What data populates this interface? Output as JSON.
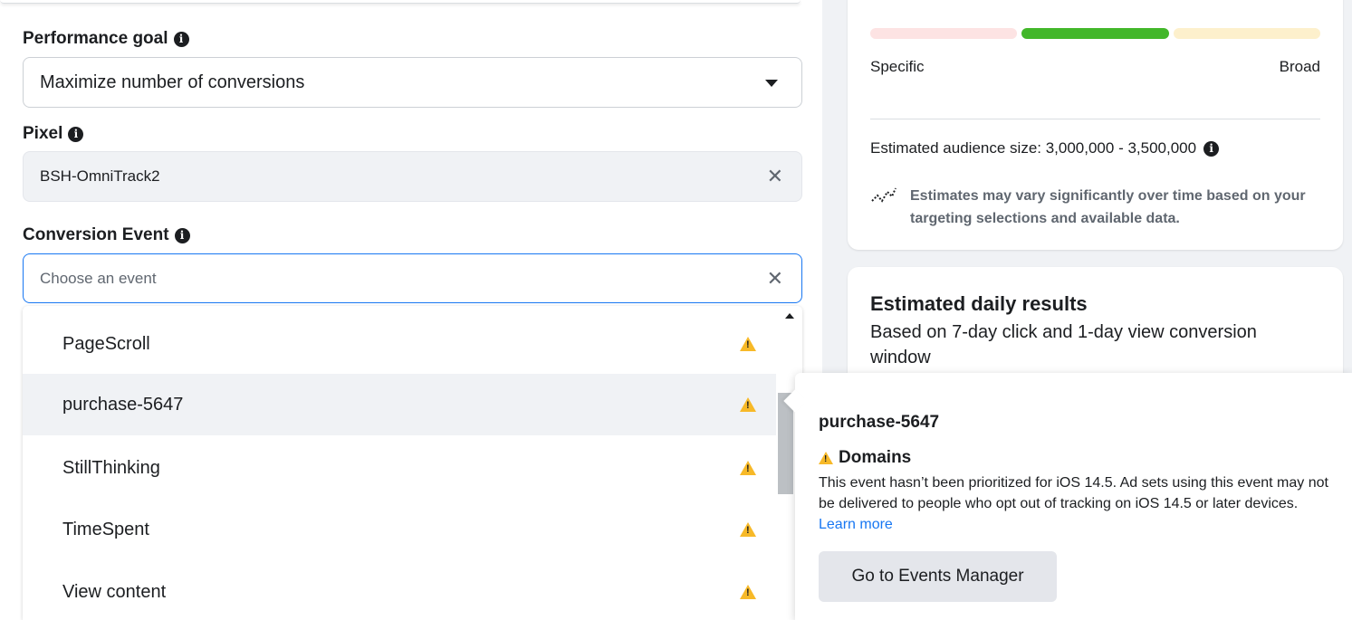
{
  "performance_goal": {
    "label": "Performance goal",
    "value": "Maximize number of conversions"
  },
  "pixel": {
    "label": "Pixel",
    "value": "BSH-OmniTrack2"
  },
  "conversion_event": {
    "label": "Conversion Event",
    "placeholder": "Choose an event",
    "options": [
      {
        "label": "PageScroll",
        "warning": true
      },
      {
        "label": "purchase-5647",
        "warning": true,
        "hovered": true
      },
      {
        "label": "StillThinking",
        "warning": true
      },
      {
        "label": "TimeSpent",
        "warning": true
      },
      {
        "label": "View content",
        "warning": true
      }
    ]
  },
  "audience": {
    "specific_label": "Specific",
    "broad_label": "Broad",
    "size_text": "Estimated audience size: 3,000,000 - 3,500,000",
    "note": "Estimates may vary significantly over time based on your targeting selections and available data.",
    "gauge_colors": [
      "#fde3e3",
      "#42b72a",
      "#fdf0cc"
    ]
  },
  "daily_results": {
    "title": "Estimated daily results",
    "subtitle": "Based on 7-day click and 1-day view conversion window"
  },
  "tooltip": {
    "title": "purchase-5647",
    "heading": "Domains",
    "body": "This event hasn’t been prioritized for iOS 14.5. Ad sets using this event may not be delivered to people who opt out of tracking on iOS 14.5 or later devices.",
    "link": "Learn more",
    "button": "Go to Events Manager"
  },
  "colors": {
    "accent": "#1877f2",
    "warning": "#f7b928"
  }
}
